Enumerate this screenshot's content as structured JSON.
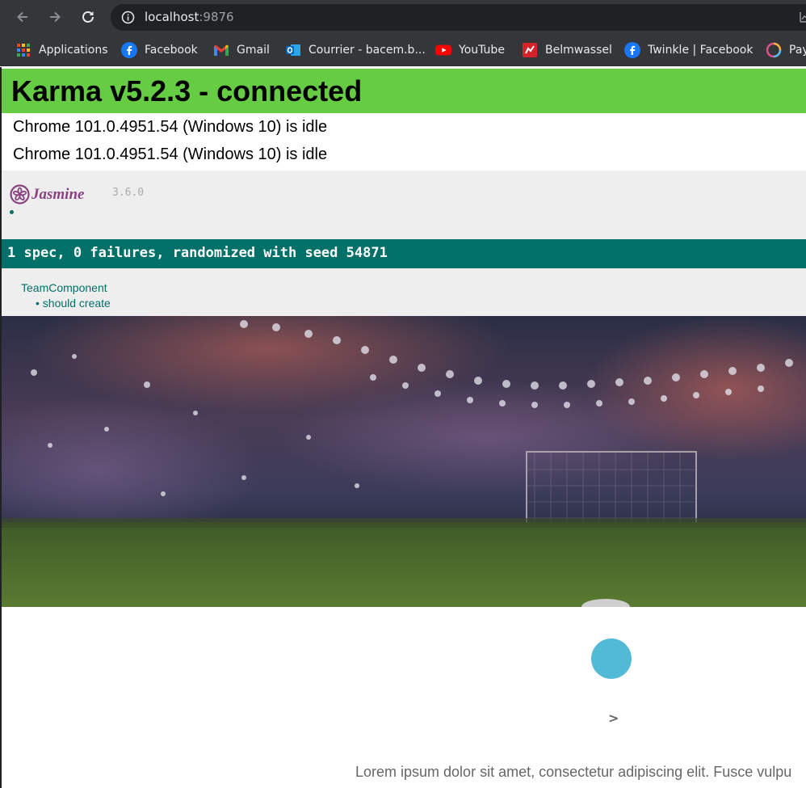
{
  "browser": {
    "url_host": "localhost",
    "url_port": ":9876"
  },
  "bookmarks": [
    {
      "label": "Applications",
      "icon": "apps-grid-icon"
    },
    {
      "label": "Facebook",
      "icon": "facebook-icon"
    },
    {
      "label": "Gmail",
      "icon": "gmail-icon"
    },
    {
      "label": "Courrier - bacem.b...",
      "icon": "outlook-icon"
    },
    {
      "label": "YouTube",
      "icon": "youtube-icon"
    },
    {
      "label": "Belmwassel",
      "icon": "belmwassel-icon"
    },
    {
      "label": "Twinkle | Facebook",
      "icon": "facebook-icon"
    },
    {
      "label": "Pay",
      "icon": "pay-ring-icon"
    }
  ],
  "karma": {
    "banner_title": "Karma v5.2.3 - connected",
    "browsers": [
      "Chrome 101.0.4951.54 (Windows 10) is idle",
      "Chrome 101.0.4951.54 (Windows 10) is idle"
    ]
  },
  "jasmine": {
    "logo_text": "Jasmine",
    "version": "3.6.0",
    "summary": "1 spec, 0 failures, randomized with seed 54871",
    "suite": "TeamComponent",
    "spec": "• should create"
  },
  "content": {
    "next_arrow": ">",
    "lorem": "Lorem ipsum dolor sit amet, consectetur adipiscing elit. Fusce vulpu"
  },
  "colors": {
    "karma_green": "#66cc44",
    "jasmine_teal": "#007069",
    "jasmine_purple": "#8a4182",
    "spinner_blue": "#52bad5"
  }
}
